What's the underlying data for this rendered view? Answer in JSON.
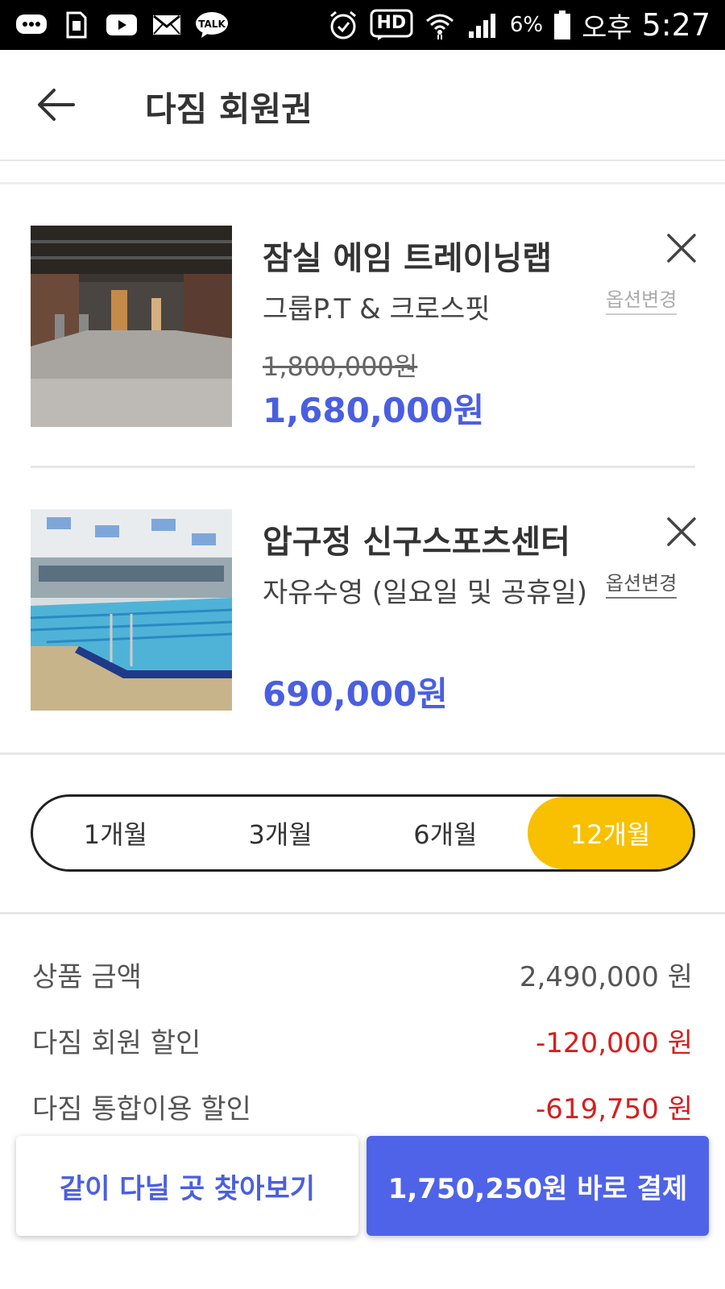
{
  "status_bar": {
    "hd_label": "HD",
    "battery_pct": "6%",
    "ampm": "오후",
    "time": "5:27",
    "icons": [
      "message-icon",
      "sim-icon",
      "youtube-icon",
      "mail-icon",
      "kakaotalk-icon",
      "alarm-icon",
      "hd-icon",
      "wifi-icon",
      "signal-icon",
      "battery-icon"
    ]
  },
  "header": {
    "title": "다짐 회원권",
    "back_icon": "arrow-left-icon"
  },
  "items": [
    {
      "name": "잠실 에임 트레이닝랩",
      "option": "그룹P.T & 크로스핏",
      "change_label": "옵션변경",
      "original_price": "1,800,000원",
      "sale_price": "1,680,000원",
      "image": "gym-interior-photo"
    },
    {
      "name": "압구정 신구스포츠센터",
      "option": "자유수영 (일요일 및 공휴일)",
      "change_label": "옵션변경",
      "original_price": "",
      "sale_price": "690,000원",
      "image": "indoor-swimming-pool-photo"
    }
  ],
  "period_options": [
    "1개월",
    "3개월",
    "6개월",
    "12개월"
  ],
  "selected_period": "12개월",
  "summary": [
    {
      "label": "상품 금액",
      "value": "2,490,000 원",
      "type": "normal"
    },
    {
      "label": "다짐 회원 할인",
      "value": "-120,000 원",
      "type": "discount"
    },
    {
      "label": "다짐 통합이용 할인",
      "value": "-619,750 원",
      "type": "discount"
    }
  ],
  "buttons": {
    "find_together": "같이 다닐 곳 찾아보기",
    "pay_now": "1,750,250원 바로 결제"
  },
  "colors": {
    "accent_blue": "#4f63e8",
    "price_blue": "#4a5fe0",
    "selected_yellow": "#f8c000",
    "discount_red": "#d61e1e"
  }
}
